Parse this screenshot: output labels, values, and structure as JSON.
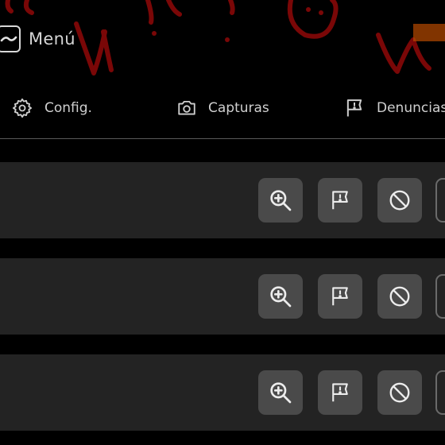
{
  "header": {
    "menu_label": "Menú"
  },
  "nav": {
    "items": [
      {
        "label": "Config.",
        "icon": "gear-icon"
      },
      {
        "label": "Capturas",
        "icon": "camera-icon"
      },
      {
        "label": "Denuncias",
        "icon": "report-flag-icon"
      }
    ]
  },
  "rows": [
    {
      "actions": [
        "zoom-in-icon",
        "report-flag-icon",
        "block-icon"
      ]
    },
    {
      "actions": [
        "zoom-in-icon",
        "report-flag-icon",
        "block-icon"
      ]
    },
    {
      "actions": [
        "zoom-in-icon",
        "report-flag-icon",
        "block-icon"
      ]
    }
  ],
  "colors": {
    "background": "#000000",
    "row_background": "#232323",
    "button_background": "#4a4a4a",
    "icon_color": "#e6e6e6",
    "art_red": "#8b0000"
  }
}
